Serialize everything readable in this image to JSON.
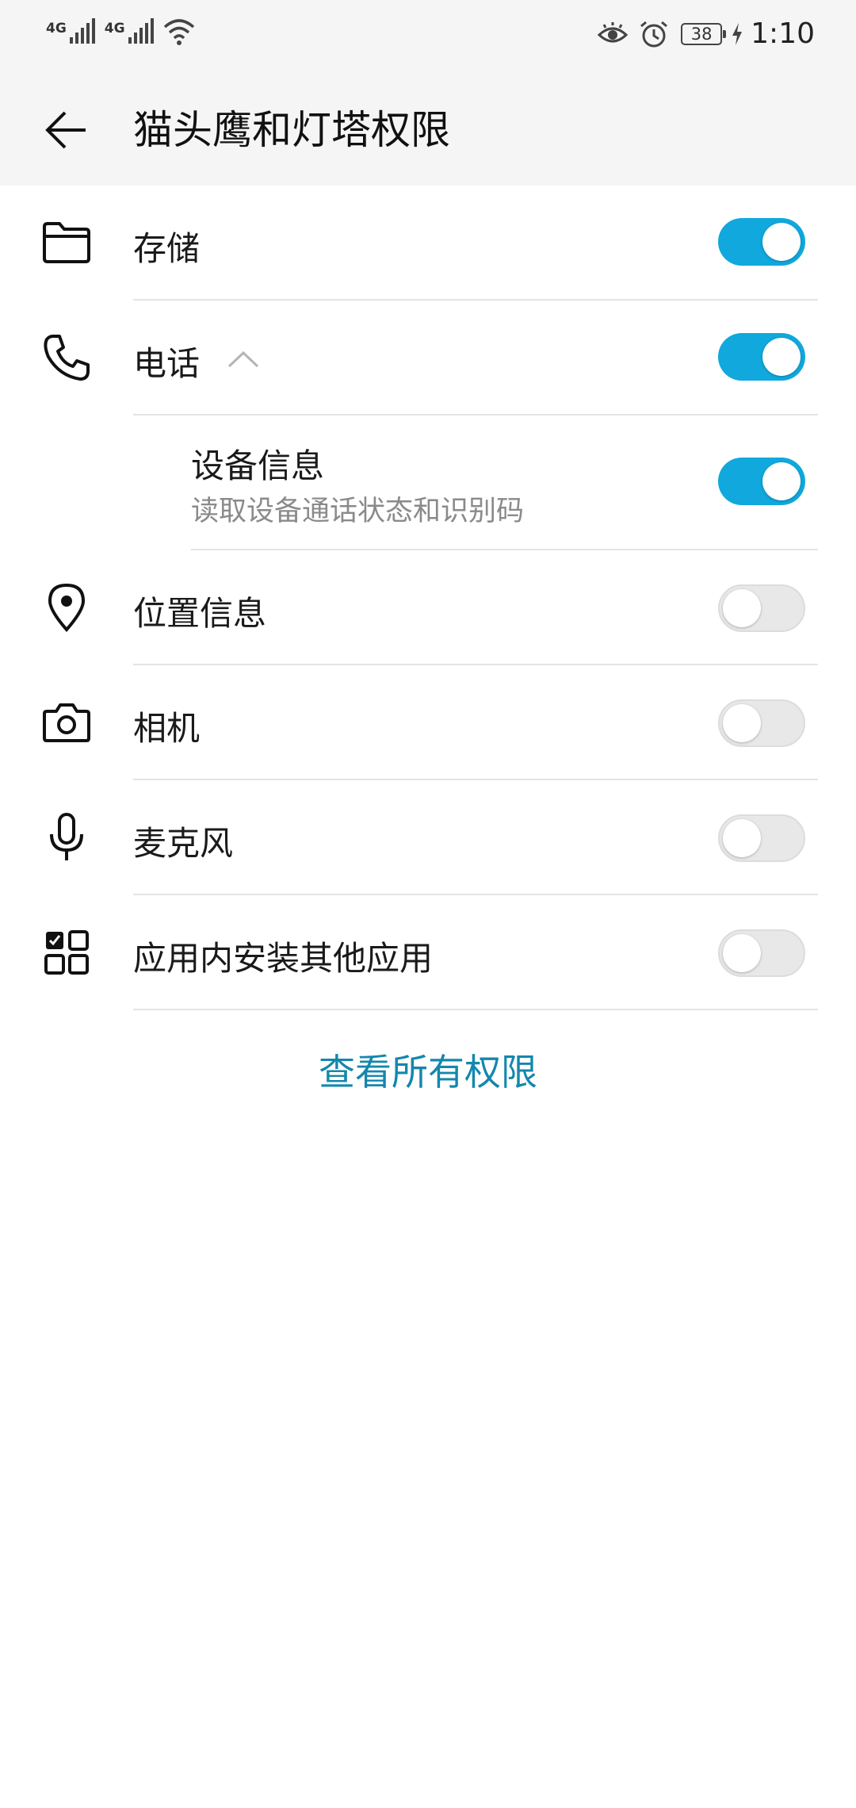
{
  "status_bar": {
    "net1": "4G",
    "net2": "4G",
    "battery": "38",
    "time": "1:10"
  },
  "header": {
    "title": "猫头鹰和灯塔权限"
  },
  "permissions": [
    {
      "label": "存储",
      "enabled": true,
      "icon": "folder-icon"
    },
    {
      "label": "电话",
      "enabled": true,
      "icon": "phone-icon",
      "expanded": true
    },
    {
      "label": "设备信息",
      "description": "读取设备通话状态和识别码",
      "enabled": true,
      "sub": true
    },
    {
      "label": "位置信息",
      "enabled": false,
      "icon": "location-pin-icon"
    },
    {
      "label": "相机",
      "enabled": false,
      "icon": "camera-icon"
    },
    {
      "label": "麦克风",
      "enabled": false,
      "icon": "microphone-icon"
    },
    {
      "label": "应用内安装其他应用",
      "enabled": false,
      "icon": "apps-grid-icon"
    }
  ],
  "footer": {
    "view_all": "查看所有权限"
  },
  "colors": {
    "toggle_on": "#10a8dd",
    "toggle_off": "#e8e8e8",
    "link": "#1487ad",
    "header_bg": "#f5f5f5"
  }
}
